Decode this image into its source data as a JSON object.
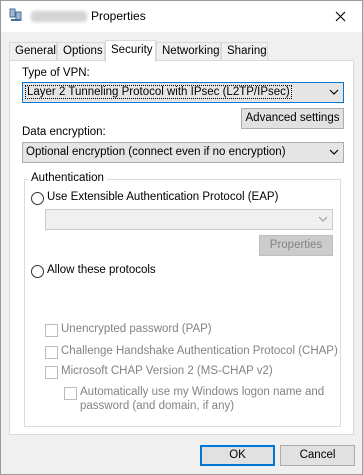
{
  "window": {
    "title": "Properties",
    "icon": "network-connection-icon",
    "close_icon": "close-icon"
  },
  "tabs": [
    {
      "label": "General",
      "active": false
    },
    {
      "label": "Options",
      "active": false
    },
    {
      "label": "Security",
      "active": true
    },
    {
      "label": "Networking",
      "active": false
    },
    {
      "label": "Sharing",
      "active": false
    }
  ],
  "security": {
    "vpn_type_label": "Type of VPN:",
    "vpn_type_value": "Layer 2 Tunneling Protocol with IPsec (L2TP/IPsec)",
    "advanced_settings_label": "Advanced settings",
    "encryption_label": "Data encryption:",
    "encryption_value": "Optional encryption (connect even if no encryption)",
    "authentication": {
      "group_label": "Authentication",
      "use_eap_label": "Use Extensible Authentication Protocol (EAP)",
      "use_eap_selected": false,
      "eap_combo_value": "",
      "properties_label": "Properties",
      "allow_protocols_label": "Allow these protocols",
      "allow_protocols_selected": false,
      "protocols": [
        {
          "label": "Unencrypted password (PAP)",
          "checked": false,
          "enabled": false
        },
        {
          "label": "Challenge Handshake Authentication Protocol (CHAP)",
          "checked": false,
          "enabled": false
        },
        {
          "label": "Microsoft CHAP Version 2 (MS-CHAP v2)",
          "checked": false,
          "enabled": false
        }
      ],
      "auto_logon_line1": "Automatically use my Windows logon name and",
      "auto_logon_line2": "password (and domain, if any)",
      "auto_logon_checked": false
    }
  },
  "footer": {
    "ok_label": "OK",
    "cancel_label": "Cancel"
  },
  "colors": {
    "accent": "#0078d7",
    "dialog_bg": "#f0f0f0",
    "disabled_text": "#838383"
  }
}
